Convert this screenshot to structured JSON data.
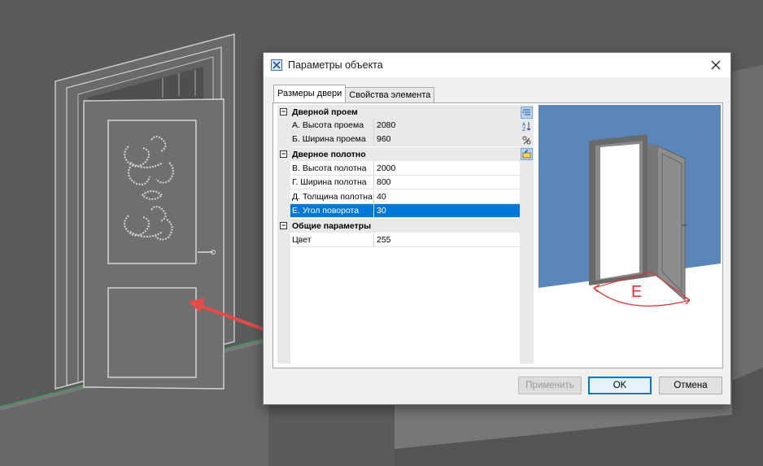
{
  "dialog": {
    "title": "Параметры объекта",
    "icon": "app-logo-icon",
    "close_icon": "close-icon"
  },
  "tabs": [
    {
      "label": "Размеры двери",
      "active": true
    },
    {
      "label": "Свойства элемента",
      "active": false
    }
  ],
  "property_grid": {
    "categories": [
      {
        "name": "Дверной проем",
        "toggle": "⊟",
        "items": [
          {
            "name": "А. Высота проема",
            "value": "2080",
            "readonly": true
          },
          {
            "name": "Б. Ширина проема",
            "value": "960",
            "readonly": true
          }
        ]
      },
      {
        "name": "Дверное полотно",
        "toggle": "⊟",
        "items": [
          {
            "name": "В. Высота полотна",
            "value": "2000"
          },
          {
            "name": "Г. Ширина полотна",
            "value": "800"
          },
          {
            "name": "Д. Толщина полотна",
            "value": "40"
          },
          {
            "name": "Е. Угол поворота",
            "value": "30",
            "selected": true
          }
        ]
      },
      {
        "name": "Общие параметры",
        "toggle": "⊟",
        "items": [
          {
            "name": "Цвет",
            "value": "255"
          }
        ]
      }
    ],
    "toolbar": [
      "categorized-icon",
      "sort-alphabetical-icon",
      "property-pages-icon",
      "properties-icon"
    ]
  },
  "preview": {
    "label": "E",
    "colors": {
      "wall": "#5a86ba",
      "floor": "#ffffff",
      "arc": "#e03030"
    }
  },
  "buttons": {
    "apply": "Применить",
    "ok": "OK",
    "cancel": "Отмена"
  },
  "colors": {
    "selection": "#0078d7",
    "background_scene": "#5a5a5a",
    "arrow": "#e84a4a"
  }
}
